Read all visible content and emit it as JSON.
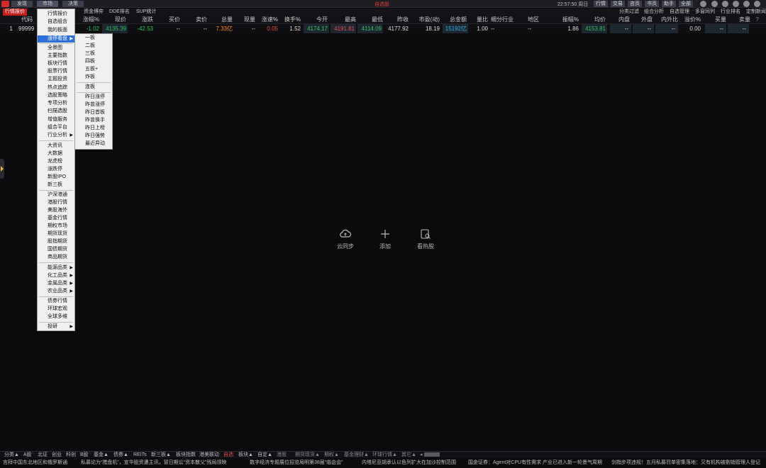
{
  "titlebar": {
    "tabs": [
      "发现",
      "市场",
      "决策"
    ],
    "app_title": "自选股",
    "clock": "22:57:50 周日",
    "right_buttons": [
      "行情",
      "交易",
      "咨页",
      "书页",
      "助手",
      "全部"
    ]
  },
  "toolbar": {
    "active": "行情报价",
    "items": [
      "资金博弈",
      "DDE排名",
      "SUP统计"
    ],
    "right_items": [
      "分类过滤",
      "组合分析",
      "自选管理",
      "多窗同列",
      "行业排名",
      "定制新闻"
    ]
  },
  "table": {
    "headers": [
      "代码",
      "涨幅%",
      "现价",
      "涨跌",
      "买价",
      "卖价",
      "总量",
      "现量",
      "涨速%",
      "换手%",
      "今开",
      "最高",
      "最低",
      "昨收",
      "市盈(动)",
      "总金额",
      "量比",
      "细分行业",
      "地区",
      "振幅%",
      "均价",
      "内盘",
      "外盘",
      "内外比",
      "溢价%",
      "买量",
      "卖量"
    ],
    "row": {
      "idx": "1",
      "code": "99999",
      "chg_pct": "-1.02",
      "price": "4135.39",
      "chg": "-42.53",
      "bid": "--",
      "ask": "--",
      "vol": "7.33亿",
      "cur_vol": "--",
      "speed": "0.05",
      "turnover": "1.52",
      "open": "4174.17",
      "high": "4191.81",
      "low": "4114.09",
      "prev": "4177.92",
      "pe": "18.19",
      "amount": "15192亿",
      "vol_ratio": "1.00",
      "industry": "--",
      "region": "--",
      "amp": "1.86",
      "avg": "4153.81",
      "inner": "--",
      "outer": "--",
      "io_ratio": "--",
      "premium": "0.00",
      "buy_vol": "--",
      "sell_vol": "--"
    }
  },
  "menu1": {
    "items": [
      "行情报价",
      "自选组合",
      "我的板面",
      "涨停看盘",
      "全景图",
      "主要指数",
      "板块行情",
      "股票行情",
      "主题投资",
      "热点追踪",
      "选股策略",
      "专项分析",
      "扫描选股",
      "增值服务",
      "组合平台",
      "行业分析",
      "大资讯",
      "大数据",
      "龙虎榜",
      "涨跌停",
      "新股IPO",
      "新三板",
      "沪深港通",
      "港股行情",
      "美股海外",
      "基金行情",
      "期权市场",
      "期货现货",
      "股指期货",
      "国债期货",
      "商品期货",
      "能源品类",
      "化工品类",
      "金属品类",
      "农业品类",
      "债券行情",
      "环球宏观",
      "全球多维",
      "投研"
    ]
  },
  "menu2": {
    "items": [
      "一板",
      "二板",
      "三板",
      "四板",
      "五板+",
      "炸板",
      "连板",
      "昨日涨停",
      "昨曾涨停",
      "昨日首板",
      "昨曾换手",
      "昨日上榜",
      "昨日强势",
      "最近异动"
    ]
  },
  "center": {
    "sync": "云同步",
    "add": "添加",
    "hot": "看热股"
  },
  "bottom_tabs": [
    "分类▲",
    "A股",
    "北证",
    "创业",
    "科创",
    "B股",
    "基金▲",
    "债券▲",
    "REITs",
    "新三板▲",
    "板块指数",
    "港美联动",
    "自选",
    "板块▲",
    "自定▲",
    "港股",
    "期货现货▲",
    "期权▲",
    "基金理财▲",
    "环球行情▲",
    "其它▲"
  ],
  "ticker": [
    "言拜中国东北地区和俄罗斯通",
    "私募论为“搅盘机”，宣华股资遭主讯，冒日期讼“资本散父”残局领映",
    "数字经济专题展位招览局明第38届“临会会”",
    "内塔尼亚胡承认以色列扩大在加沙控制范围",
    "国金证券：Agent对CPU有性需求 产业已进入新一轮景气周期",
    "剑指步项违规！五月私募罚单密集落地：又有机构被剔销管理人登记"
  ]
}
